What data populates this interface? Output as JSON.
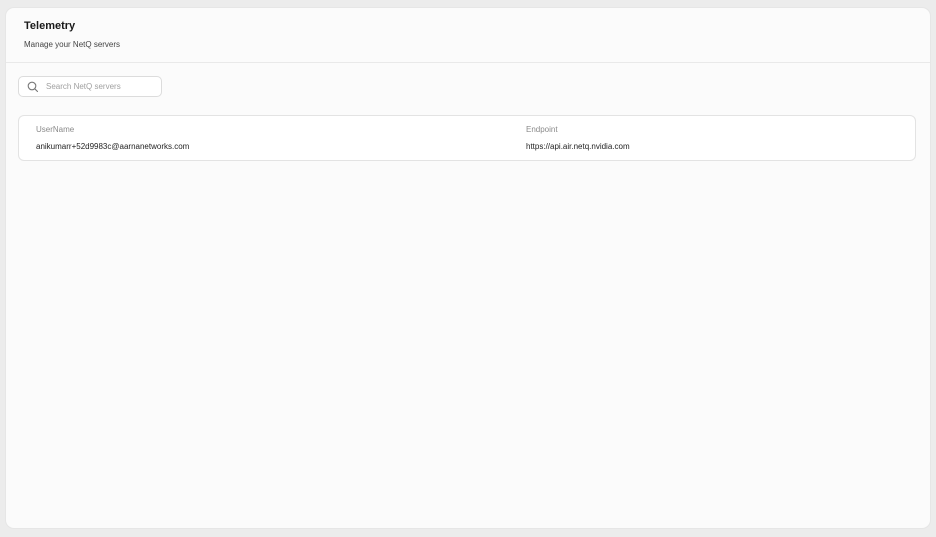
{
  "header": {
    "title": "Telemetry",
    "subtitle": "Manage your NetQ servers"
  },
  "search": {
    "placeholder": "Search NetQ servers",
    "value": "",
    "icon": "search-icon"
  },
  "table": {
    "columns": [
      "UserName",
      "Endpoint"
    ],
    "rows": [
      [
        "anikumarr+52d9983c@aarnanetworks.com",
        "https://api.air.netq.nvidia.com"
      ]
    ]
  }
}
